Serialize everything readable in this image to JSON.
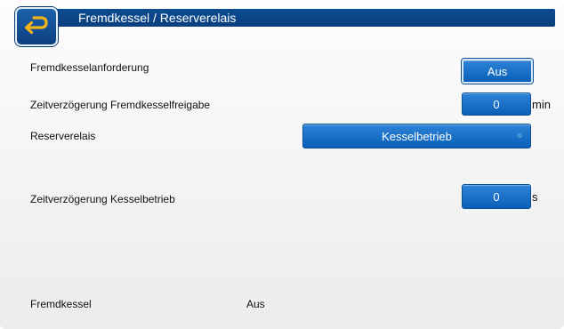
{
  "header": {
    "title": "Fremdkessel / Reserverelais"
  },
  "rows": [
    {
      "label": "Fremdkesselanforderung",
      "value": "Aus",
      "unit": ""
    },
    {
      "label": "Zeitverzögerung Fremdkesselfreigabe",
      "value": "0",
      "unit": "min"
    },
    {
      "label": "Reserverelais",
      "value": "Kesselbetrieb",
      "unit": ""
    },
    {
      "label": "Zeitverzögerung Kesselbetrieb",
      "value": "0",
      "unit": "s"
    }
  ],
  "status": {
    "label": "Fremdkessel",
    "value": "Aus"
  },
  "icons": {
    "back": "back-arrow-icon",
    "dropdown": "dropdown-indicator-icon"
  },
  "colors": {
    "header": "#0a3f7c",
    "button": "#1a6fc6"
  }
}
